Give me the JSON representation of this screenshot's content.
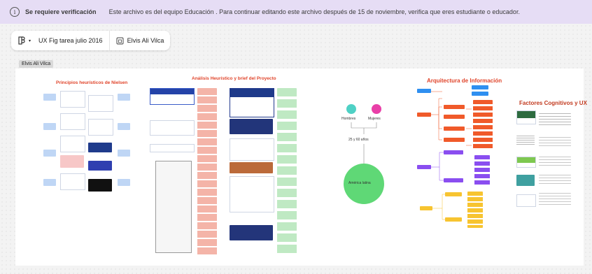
{
  "banner": {
    "title": "Se requiere verificación",
    "message": "Este archivo es del equipo Educación . Para continuar editando este archivo después de 15 de noviembre, verifica que eres estudiante o educador."
  },
  "toolbar": {
    "file_name": "UX Fig tarea julio 2016",
    "user_name": "Elvis Ali Vilca"
  },
  "frame": {
    "label": "Elvis Ali Vilca"
  },
  "sections": {
    "nielsen": "Principios heurísticos de Nielsen",
    "analysis": "Análisis Heurístico y brief del Proyecto",
    "architecture": "Arquitectura de Información",
    "factors": "Factores Cognitivos y UX"
  },
  "persona": {
    "men": "Hombres",
    "women": "Mujeres",
    "age": "25 y 60 años",
    "region": "América latina"
  },
  "colors": {
    "banner_bg": "#e6ddf5",
    "accent": "#e0442a",
    "teal": "#4fd1c5",
    "pink": "#e93fa8",
    "green": "#5fd876",
    "blue": "#2f8ff0",
    "orange": "#f05a2a",
    "purple": "#8a4ef0",
    "yellow": "#f7c430"
  }
}
